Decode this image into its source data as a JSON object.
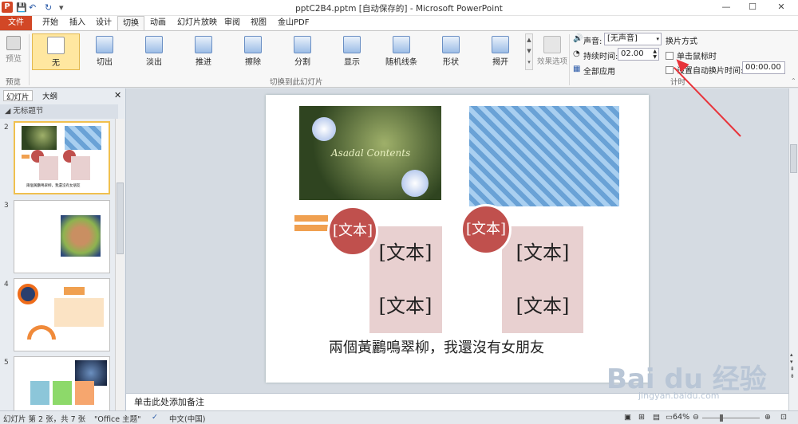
{
  "window": {
    "title": "pptC2B4.pptm [自动保存的] - Microsoft PowerPoint",
    "app_icon": "P"
  },
  "tabs": [
    "文件",
    "开始",
    "插入",
    "设计",
    "切换",
    "动画",
    "幻灯片放映",
    "审阅",
    "视图",
    "金山PDF"
  ],
  "ribbon": {
    "preview_label": "预览",
    "preview_group": "预览",
    "transitions": [
      "无",
      "切出",
      "淡出",
      "推进",
      "擦除",
      "分割",
      "显示",
      "随机线条",
      "形状",
      "揭开"
    ],
    "transitions_group": "切换到此幻灯片",
    "effect_options": "效果选项",
    "sound_label": "声音:",
    "sound_value": "[无声音]",
    "duration_label": "持续时间:",
    "duration_value": "02.00",
    "apply_all": "全部应用",
    "advance_title": "换片方式",
    "on_click": "单击鼠标时",
    "after_time": "设置自动换片时间:",
    "after_time_value": "00:00.00",
    "timing_group": "计时"
  },
  "left_pane": {
    "tab_slides": "幻灯片",
    "tab_outline": "大纲",
    "section": "无标题节",
    "slide_numbers": [
      "2",
      "3",
      "4",
      "5"
    ],
    "thumb2_caption": "兩個黃鸝鳴翠柳，我還沒有女朋友"
  },
  "slide": {
    "circle_text_1": "[文本]",
    "circle_text_2": "[文本]",
    "rect1_text_a": "[文本]",
    "rect1_text_b": "[文本]",
    "rect2_text_a": "[文本]",
    "rect2_text_b": "[文本]",
    "photo_text": "Asadal Contents",
    "caption": "兩個黃鸝鳴翠柳，我還沒有女朋友"
  },
  "notes_placeholder": "单击此处添加备注",
  "status": {
    "slide_info": "幻灯片 第 2 张，共 7 张",
    "theme": "\"Office 主题\"",
    "language": "中文(中国)",
    "zoom": "64%"
  },
  "watermark": {
    "brand": "Bai du 经验",
    "url": "jingyan.baidu.com"
  },
  "colors": {
    "file_tab": "#d24726",
    "accent_circle": "#c0504d",
    "annotation_arrow": "#e8333a"
  }
}
